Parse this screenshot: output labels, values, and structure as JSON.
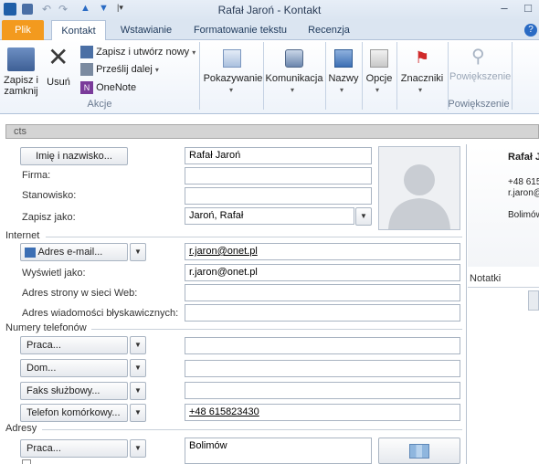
{
  "window": {
    "title": "Rafał Jaroń  -  Kontakt"
  },
  "tabs": [
    {
      "label": "Plik"
    },
    {
      "label": "Kontakt"
    },
    {
      "label": "Wstawianie"
    },
    {
      "label": "Formatowanie tekstu"
    },
    {
      "label": "Recenzja"
    }
  ],
  "ribbon": {
    "save_close": "Zapisz i zamknij",
    "delete": "Usuń",
    "save_new": "Zapisz i utwórz nowy",
    "forward": "Prześlij dalej",
    "onenote": "OneNote",
    "group_actions": "Akcje",
    "show": "Pokazywanie",
    "communicate": "Komunikacja",
    "names": "Nazwy",
    "options": "Opcje",
    "tags": "Znaczniki",
    "zoom": "Powiększenie",
    "group_zoom": "Powiększenie"
  },
  "section_bar": "cts",
  "form": {
    "full_name_button": "Imię i nazwisko...",
    "full_name_value": "Rafał Jaroń",
    "company_label": "Firma:",
    "company_value": "",
    "job_title_label": "Stanowisko:",
    "job_title_value": "",
    "file_as_label": "Zapisz jako:",
    "file_as_value": "Jaroń, Rafał",
    "internet_section": "Internet",
    "email_button": "Adres e-mail...",
    "email_value": "r.jaron@onet.pl",
    "display_as_label": "Wyświetl jako:",
    "display_as_value": "r.jaron@onet.pl",
    "web_label": "Adres strony w sieci Web:",
    "web_value": "",
    "im_label": "Adres wiadomości błyskawicznych:",
    "im_value": "",
    "phones_section": "Numery telefonów",
    "phone_work_button": "Praca...",
    "phone_work_value": "",
    "phone_home_button": "Dom...",
    "phone_home_value": "",
    "phone_fax_button": "Faks służbowy...",
    "phone_fax_value": "",
    "phone_mobile_button": "Telefon komórkowy...",
    "phone_mobile_value": "+48 615823430",
    "addresses_section": "Adresy",
    "address_button": "Praca...",
    "address_value": "Bolimów"
  },
  "card": {
    "name": "Rafał J",
    "phone": "+48 615",
    "email": "r.jaron@",
    "city": "Bolimów"
  },
  "notes_label": "Notatki"
}
